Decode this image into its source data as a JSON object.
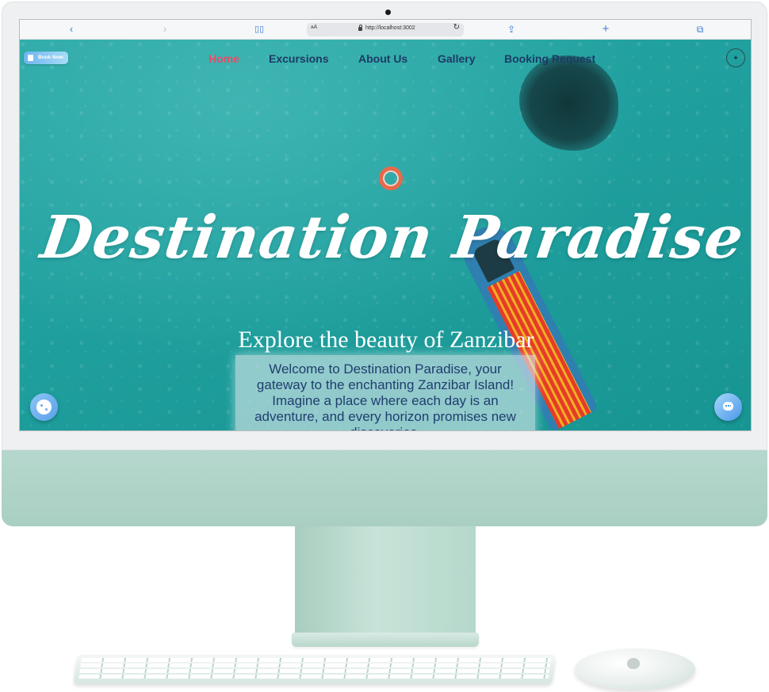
{
  "browser": {
    "url": "http://localhost:3002",
    "text_size_label": "ᴀA",
    "back_icon": "chevron-left-icon",
    "forward_icon": "chevron-right-icon",
    "reader_icon": "book-icon",
    "reload_icon": "reload-icon",
    "share_icon": "share-icon",
    "new_tab_icon": "plus-icon",
    "tabs_icon": "tabs-icon"
  },
  "header": {
    "book_now_label": "Book Now",
    "nav": [
      {
        "label": "Home",
        "active": true
      },
      {
        "label": "Excursions",
        "active": false
      },
      {
        "label": "About Us",
        "active": false
      },
      {
        "label": "Gallery",
        "active": false
      },
      {
        "label": "Booking Request",
        "active": false
      }
    ],
    "logo_icon": "logo-icon"
  },
  "hero": {
    "title": "Destination Paradise",
    "subtitle": "Explore the beauty of Zanzibar",
    "welcome_text": "Welcome to Destination Paradise, your gateway to the enchanting Zanzibar Island! Imagine a place where each day is an adventure, and every horizon promises new discoveries."
  },
  "floating": {
    "cookie_icon": "cookie-icon",
    "chat_icon": "chat-icon"
  },
  "colors": {
    "nav_active": "#e94b66",
    "nav_text": "#1d3a66",
    "sea": "#1f9f9e",
    "imac_body": "#b6d7cd"
  }
}
